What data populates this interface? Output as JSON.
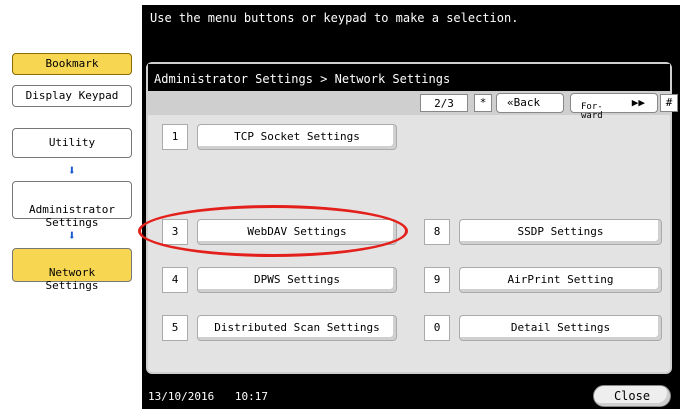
{
  "instruction": "Use the menu buttons or keypad to make a selection.",
  "sidebar": {
    "bookmark": "Bookmark",
    "display_keypad": "Display Keypad",
    "path": [
      {
        "label": "Utility"
      },
      {
        "label": "Administrator\nSettings"
      },
      {
        "label": "Network\nSettings"
      }
    ]
  },
  "main": {
    "breadcrumb": "Administrator Settings > Network Settings",
    "page_indicator": "2/3",
    "star_key": "*",
    "back_label": "«Back",
    "forward_label": "For-\nward",
    "hash_key": "#",
    "items": [
      {
        "num": "1",
        "label": "TCP Socket Settings"
      },
      {
        "num": "3",
        "label": "WebDAV Settings"
      },
      {
        "num": "4",
        "label": "DPWS Settings"
      },
      {
        "num": "5",
        "label": "Distributed Scan Settings"
      },
      {
        "num": "8",
        "label": "SSDP Settings"
      },
      {
        "num": "9",
        "label": "AirPrint Setting"
      },
      {
        "num": "0",
        "label": "Detail Settings"
      }
    ]
  },
  "footer": {
    "date": "13/10/2016",
    "time": "10:17",
    "close_label": "Close"
  },
  "colors": {
    "accent_yellow": "#f7d652",
    "arrow_blue": "#1c58d0",
    "highlight_red": "#e3201b"
  }
}
